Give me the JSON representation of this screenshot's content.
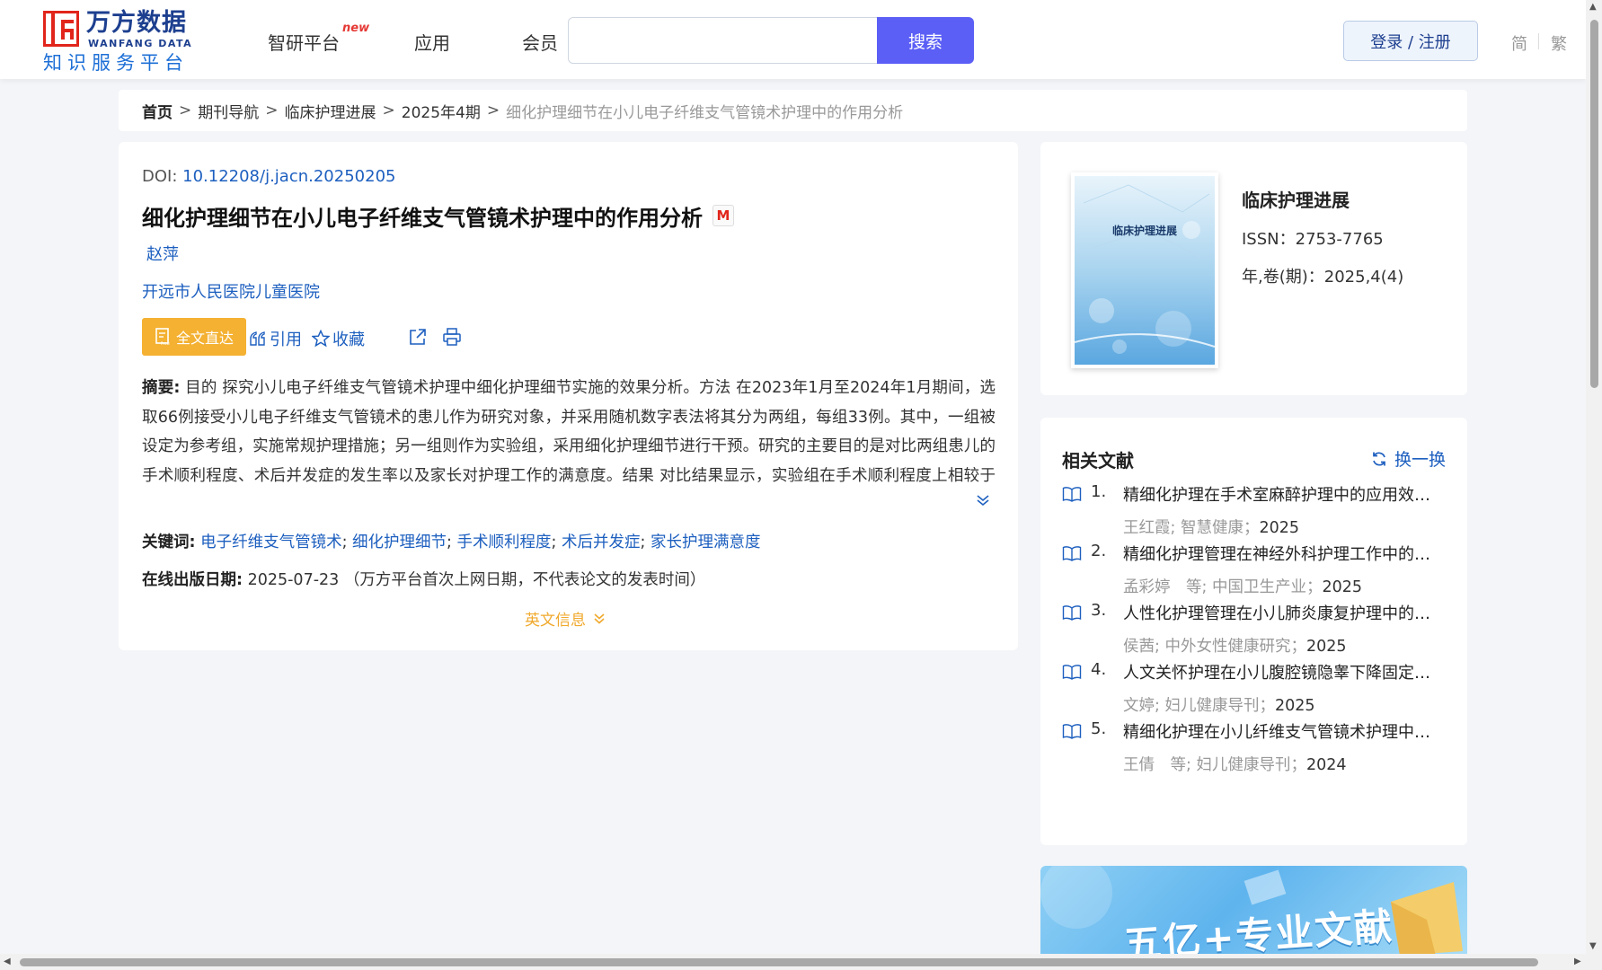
{
  "header": {
    "logo_cn": "万方数据",
    "logo_en": "WANFANG DATA",
    "logo_sub": "知识服务平台",
    "nav": [
      "智研平台",
      "应用",
      "会员"
    ],
    "nav_badge": "new",
    "search_placeholder": "",
    "search_button": "搜索",
    "login_button": "登录 / 注册",
    "lang_simplified": "简",
    "lang_traditional": "繁"
  },
  "breadcrumb": {
    "home": "首页",
    "items": [
      "期刊导航",
      "临床护理进展",
      "2025年4期"
    ],
    "current": "细化护理细节在小儿电子纤维支气管镜术护理中的作用分析",
    "separator": ">"
  },
  "article": {
    "doi_label": "DOI: ",
    "doi": "10.12208/j.jacn.20250205",
    "title": "细化护理细节在小儿电子纤维支气管镜术护理中的作用分析",
    "author": "赵萍",
    "affiliation": "开远市人民医院儿童医院",
    "fulltext_button": "全文直达",
    "actions": {
      "cite": "引用",
      "favorite": "收藏"
    },
    "abstract_label": "摘要:",
    "abstract": "目的 探究小儿电子纤维支气管镜术护理中细化护理细节实施的效果分析。方法 在2023年1月至2024年1月期间，选取66例接受小儿电子纤维支气管镜术的患儿作为研究对象，并采用随机数字表法将其分为两组，每组33例。其中，一组被设定为参考组，实施常规护理措施；另一组则作为实验组，采用细化护理细节进行干预。研究的主要目的是对比两组患儿的手术顺利程度、术后并发症的发生率以及家长对护理工作的满意度。结果 对比结果显示，实验组在手术顺利程度上相较于参考组展现出更高的水平（P＜0.05），且术后并发症的发生率显著低于参考组（P＜0.05）。此外，实验组家长对护理...",
    "keywords_label": "关键词:",
    "keywords": [
      "电子纤维支气管镜术",
      "细化护理细节",
      "手术顺利程度",
      "术后并发症",
      "家长护理满意度"
    ],
    "pubdate_label": "在线出版日期:",
    "pubdate": "2025-07-23",
    "pubdate_note": "（万方平台首次上网日期，不代表论文的发表时间）",
    "english_info": "英文信息"
  },
  "journal": {
    "cover_title": "临床护理进展",
    "name": "临床护理进展",
    "issn_label": "ISSN：",
    "issn": "2753-7765",
    "vol_label": "年,卷(期)：",
    "vol": "2025,4(4)"
  },
  "related": {
    "title": "相关文献",
    "refresh": "换一换",
    "items": [
      {
        "num": "1.",
        "title": "精细化护理在手术室麻醉护理中的应用效果分析",
        "meta": "王红霞; 智慧健康；",
        "year": "2025"
      },
      {
        "num": "2.",
        "title": "精细化护理管理在神经外科护理工作中的应用效果",
        "meta": "孟彩婷　等;  中国卫生产业；",
        "year": "2025"
      },
      {
        "num": "3.",
        "title": "人性化护理管理在小儿肺炎康复护理中的应用效果",
        "meta": "侯茜; 中外女性健康研究；",
        "year": "2025"
      },
      {
        "num": "4.",
        "title": "人文关怀护理在小儿腹腔镜隐睾下降固定术中的应用",
        "meta": "文婷; 妇儿健康导刊；",
        "year": "2025"
      },
      {
        "num": "5.",
        "title": "精细化护理在小儿纤维支气管镜术护理中的应用分析",
        "meta": "王倩　等;  妇儿健康导刊；",
        "year": "2024"
      }
    ]
  },
  "banner": {
    "text": "五亿+专业文献"
  },
  "colors": {
    "brand_blue": "#1d3f8f",
    "link_blue": "#1d5fbf",
    "search_button": "#5b5ff5",
    "fulltext_button": "#f4b132",
    "english_info": "#f0a92c"
  }
}
